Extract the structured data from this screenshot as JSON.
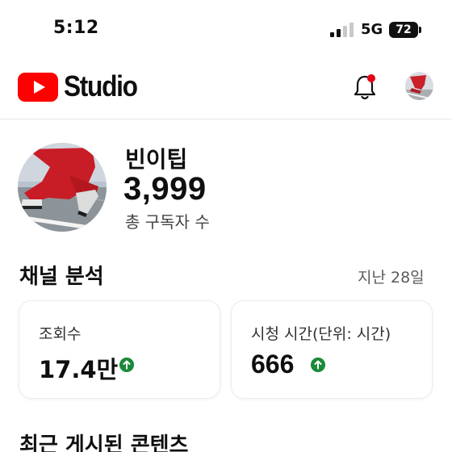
{
  "status_bar": {
    "time": "5:12",
    "network": "5G",
    "battery": "72",
    "signal_bars_active": 2,
    "signal_bars_total": 4
  },
  "header": {
    "app_name": "Studio",
    "logo_icon": "youtube-play-logo",
    "notification_icon": "bell-icon",
    "notification_badge_color": "#e60012",
    "brand_color": "#ff0000"
  },
  "channel": {
    "name": "빈이팁",
    "subscriber_count": "3,999",
    "subscriber_label": "총 구독자 수"
  },
  "analytics": {
    "title": "채널 분석",
    "period": "지난 28일",
    "cards": [
      {
        "label": "조회수",
        "value": "17.4만",
        "trend": "up"
      },
      {
        "label": "시청 시간(단위: 시간)",
        "value": "666",
        "trend": "up"
      }
    ],
    "trend_up_color": "#1a8a3a"
  },
  "recent": {
    "title": "최근 게시된 콘텐츠"
  }
}
